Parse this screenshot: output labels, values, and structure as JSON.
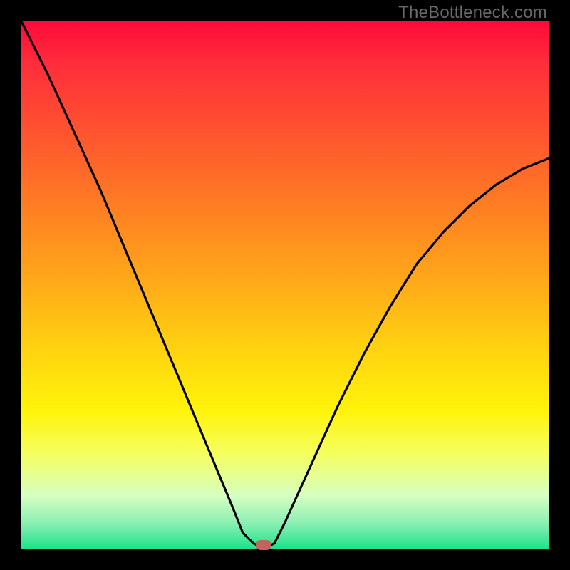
{
  "watermark": "TheBottleneck.com",
  "colors": {
    "frame": "#000000",
    "curve": "#000000",
    "marker": "#c4635b",
    "gradient_stops": [
      "#ff0a3a",
      "#ff2d3b",
      "#ff5030",
      "#ff7a24",
      "#ffa51a",
      "#ffd210",
      "#fff40a",
      "#f5ff60",
      "#d6ffc2",
      "#8df0b4",
      "#1ee28a"
    ]
  },
  "chart_data": {
    "type": "line",
    "title": "",
    "xlabel": "",
    "ylabel": "",
    "xlim": [
      0,
      100
    ],
    "ylim": [
      0,
      100
    ],
    "x": [
      0,
      5,
      10,
      15,
      20,
      25,
      30,
      35,
      40,
      42,
      44,
      46,
      48,
      50,
      55,
      60,
      65,
      70,
      75,
      80,
      85,
      90,
      95,
      100
    ],
    "values": [
      100,
      90,
      79,
      68,
      56,
      44,
      32,
      20,
      8,
      3,
      1,
      0,
      1,
      5,
      16,
      27,
      37,
      46,
      54,
      60,
      65,
      69,
      72,
      74
    ],
    "marker": {
      "x": 46,
      "y": 0
    },
    "notes": "V-shaped bottleneck curve; y is mismatch percent (0 = optimal, green). Minimum near x≈46."
  }
}
